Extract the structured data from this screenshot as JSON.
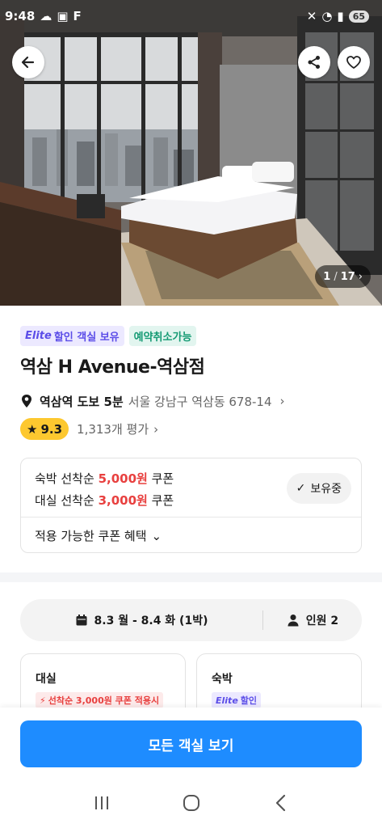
{
  "status_bar": {
    "time": "9:48",
    "carrier_glyph": "F",
    "battery": "65"
  },
  "hero": {
    "photo_current": "1",
    "photo_separator": "/",
    "photo_total": "17"
  },
  "badges": {
    "elite_word": "Elite",
    "elite_text": "할인 객실 보유",
    "cancel_text": "예약취소가능"
  },
  "hotel": {
    "name": "역삼 H Avenue-역삼점",
    "station": "역삼역 도보 5분",
    "address": "서울 강남구 역삼동 678-14",
    "rating": "9.3",
    "reviews": "1,313개 평가"
  },
  "coupons": {
    "line1_prefix": "숙박 선착순",
    "line1_amount": "5,000원",
    "line1_suffix": "쿠폰",
    "line2_prefix": "대실 선착순",
    "line2_amount": "3,000원",
    "line2_suffix": "쿠폰",
    "owned_label": "보유중",
    "benefit_label": "적용 가능한 쿠폰 혜택"
  },
  "search": {
    "dates": "8.3 월 - 8.4 화 (1박)",
    "guests": "인원 2"
  },
  "room_cards": [
    {
      "title": "대실",
      "tag": "선착순 3,000원 쿠폰 적용시"
    },
    {
      "title": "숙박",
      "tag_elite": "Elite",
      "tag": "할인"
    }
  ],
  "cta": {
    "label": "모든 객실 보기"
  },
  "colors": {
    "primary": "#1e8cff",
    "coupon_red": "#e8403f",
    "elite_purple": "#5b4de8",
    "cancel_green": "#149a73",
    "rating_yellow": "#fdc82f"
  }
}
